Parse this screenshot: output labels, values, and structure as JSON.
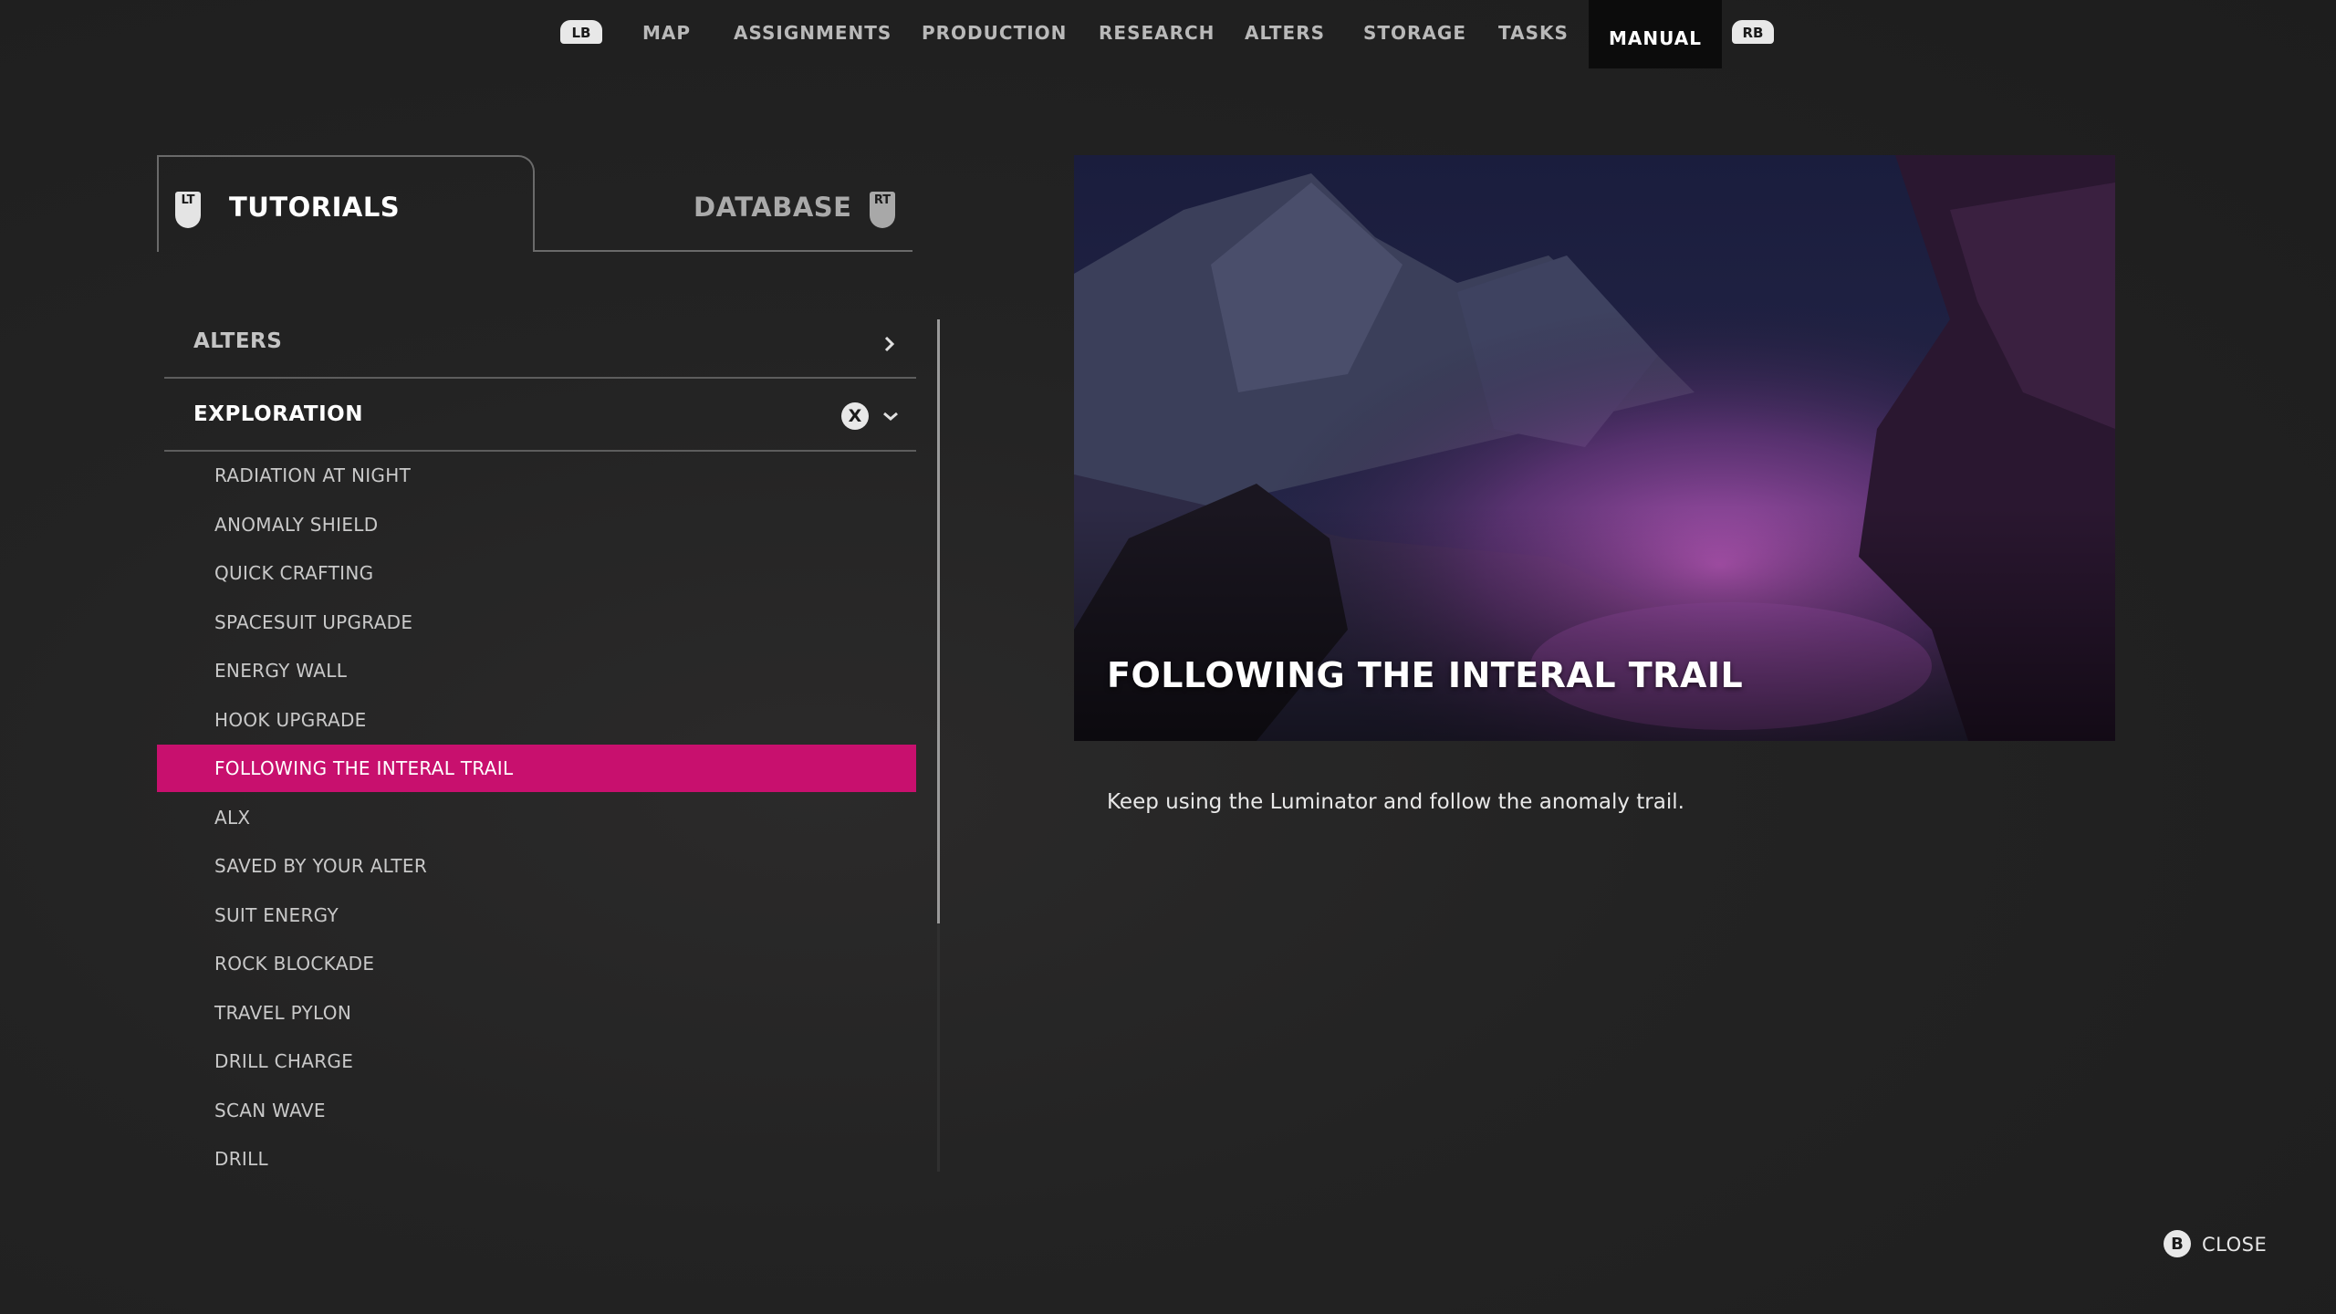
{
  "nav": {
    "lb": "LB",
    "rb": "RB",
    "items": [
      "MAP",
      "ASSIGNMENTS",
      "PRODUCTION",
      "RESEARCH",
      "ALTERS",
      "STORAGE",
      "TASKS",
      "MANUAL"
    ],
    "active": "MANUAL"
  },
  "tabs": {
    "lt": "LT",
    "rt": "RT",
    "tutorials": "TUTORIALS",
    "database": "DATABASE"
  },
  "list": {
    "categories": [
      {
        "label": "ALTERS",
        "expanded": false
      },
      {
        "label": "EXPLORATION",
        "expanded": true,
        "button": "X"
      }
    ],
    "items": [
      "RADIATION AT NIGHT",
      "ANOMALY SHIELD",
      "QUICK CRAFTING",
      "SPACESUIT UPGRADE",
      "ENERGY WALL",
      "HOOK UPGRADE",
      "FOLLOWING THE INTERAL TRAIL",
      "ALX",
      "SAVED BY YOUR ALTER",
      "SUIT ENERGY",
      "ROCK BLOCKADE",
      "TRAVEL PYLON",
      "DRILL CHARGE",
      "SCAN WAVE",
      "DRILL"
    ],
    "selected_index": 6
  },
  "preview": {
    "title": "FOLLOWING THE INTERAL TRAIL",
    "description": "Keep using the Luminator and follow the anomaly trail."
  },
  "footer": {
    "close_button": "B",
    "close_label": "CLOSE"
  },
  "colors": {
    "accent": "#c8106e",
    "background": "#232323",
    "active_tab": "#0c0c0c"
  }
}
